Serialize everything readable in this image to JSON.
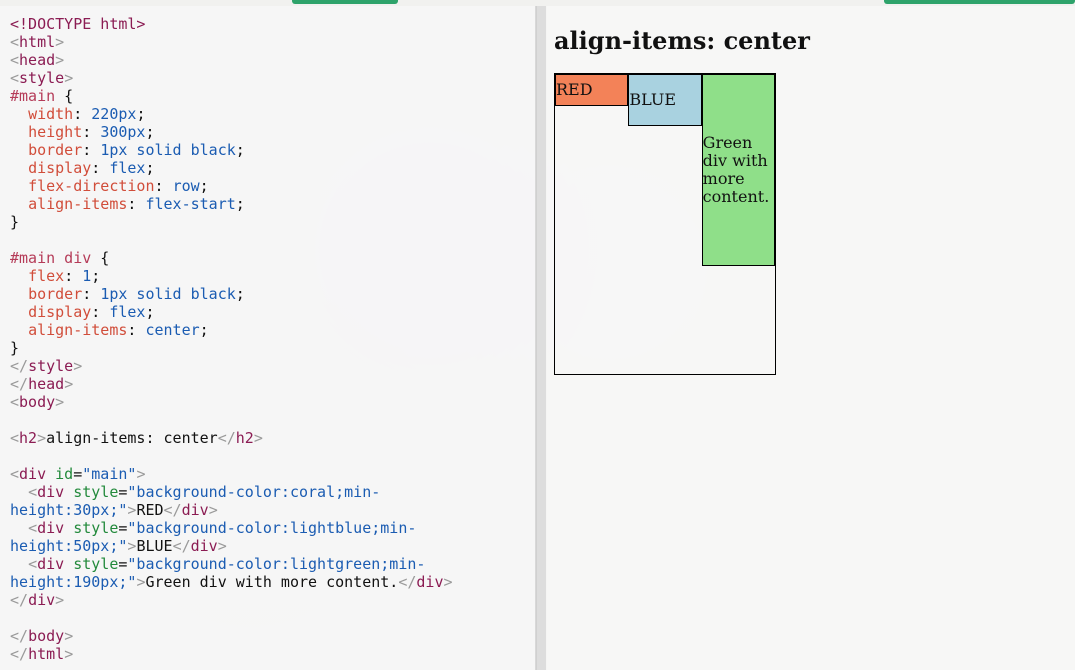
{
  "editor": {
    "lines": [
      [
        {
          "text": "<!DOCTYPE html>",
          "cls": "tok-tag"
        }
      ],
      [
        {
          "text": "<",
          "cls": "tok-bracket"
        },
        {
          "text": "html",
          "cls": "tok-tag"
        },
        {
          "text": ">",
          "cls": "tok-bracket"
        }
      ],
      [
        {
          "text": "<",
          "cls": "tok-bracket"
        },
        {
          "text": "head",
          "cls": "tok-tag"
        },
        {
          "text": ">",
          "cls": "tok-bracket"
        }
      ],
      [
        {
          "text": "<",
          "cls": "tok-bracket"
        },
        {
          "text": "style",
          "cls": "tok-tag"
        },
        {
          "text": ">",
          "cls": "tok-bracket"
        }
      ],
      [
        {
          "text": "#main",
          "cls": "tok-sel"
        },
        {
          "text": " {",
          "cls": "tok-punc"
        }
      ],
      [
        {
          "text": "  ",
          "cls": "tok-punc"
        },
        {
          "text": "width",
          "cls": "tok-prop"
        },
        {
          "text": ": ",
          "cls": "tok-punc"
        },
        {
          "text": "220px",
          "cls": "tok-val"
        },
        {
          "text": ";",
          "cls": "tok-punc"
        }
      ],
      [
        {
          "text": "  ",
          "cls": "tok-punc"
        },
        {
          "text": "height",
          "cls": "tok-prop"
        },
        {
          "text": ": ",
          "cls": "tok-punc"
        },
        {
          "text": "300px",
          "cls": "tok-val"
        },
        {
          "text": ";",
          "cls": "tok-punc"
        }
      ],
      [
        {
          "text": "  ",
          "cls": "tok-punc"
        },
        {
          "text": "border",
          "cls": "tok-prop"
        },
        {
          "text": ": ",
          "cls": "tok-punc"
        },
        {
          "text": "1px solid black",
          "cls": "tok-val"
        },
        {
          "text": ";",
          "cls": "tok-punc"
        }
      ],
      [
        {
          "text": "  ",
          "cls": "tok-punc"
        },
        {
          "text": "display",
          "cls": "tok-prop"
        },
        {
          "text": ": ",
          "cls": "tok-punc"
        },
        {
          "text": "flex",
          "cls": "tok-val"
        },
        {
          "text": ";",
          "cls": "tok-punc"
        }
      ],
      [
        {
          "text": "  ",
          "cls": "tok-punc"
        },
        {
          "text": "flex-direction",
          "cls": "tok-prop"
        },
        {
          "text": ": ",
          "cls": "tok-punc"
        },
        {
          "text": "row",
          "cls": "tok-val"
        },
        {
          "text": ";",
          "cls": "tok-punc"
        }
      ],
      [
        {
          "text": "  ",
          "cls": "tok-punc"
        },
        {
          "text": "align-items",
          "cls": "tok-prop"
        },
        {
          "text": ": ",
          "cls": "tok-punc"
        },
        {
          "text": "flex-start",
          "cls": "tok-val"
        },
        {
          "text": ";",
          "cls": "tok-punc"
        }
      ],
      [
        {
          "text": "}",
          "cls": "tok-punc"
        }
      ],
      [],
      [
        {
          "text": "#main div",
          "cls": "tok-sel"
        },
        {
          "text": " {",
          "cls": "tok-punc"
        }
      ],
      [
        {
          "text": "  ",
          "cls": "tok-punc"
        },
        {
          "text": "flex",
          "cls": "tok-prop"
        },
        {
          "text": ": ",
          "cls": "tok-punc"
        },
        {
          "text": "1",
          "cls": "tok-val"
        },
        {
          "text": ";",
          "cls": "tok-punc"
        }
      ],
      [
        {
          "text": "  ",
          "cls": "tok-punc"
        },
        {
          "text": "border",
          "cls": "tok-prop"
        },
        {
          "text": ": ",
          "cls": "tok-punc"
        },
        {
          "text": "1px solid black",
          "cls": "tok-val"
        },
        {
          "text": ";",
          "cls": "tok-punc"
        }
      ],
      [
        {
          "text": "  ",
          "cls": "tok-punc"
        },
        {
          "text": "display",
          "cls": "tok-prop"
        },
        {
          "text": ": ",
          "cls": "tok-punc"
        },
        {
          "text": "flex",
          "cls": "tok-val"
        },
        {
          "text": ";",
          "cls": "tok-punc"
        }
      ],
      [
        {
          "text": "  ",
          "cls": "tok-punc"
        },
        {
          "text": "align-items",
          "cls": "tok-prop"
        },
        {
          "text": ": ",
          "cls": "tok-punc"
        },
        {
          "text": "center",
          "cls": "tok-val"
        },
        {
          "text": ";",
          "cls": "tok-punc"
        }
      ],
      [
        {
          "text": "}",
          "cls": "tok-punc"
        }
      ],
      [
        {
          "text": "</",
          "cls": "tok-bracket"
        },
        {
          "text": "style",
          "cls": "tok-tag"
        },
        {
          "text": ">",
          "cls": "tok-bracket"
        }
      ],
      [
        {
          "text": "</",
          "cls": "tok-bracket"
        },
        {
          "text": "head",
          "cls": "tok-tag"
        },
        {
          "text": ">",
          "cls": "tok-bracket"
        }
      ],
      [
        {
          "text": "<",
          "cls": "tok-bracket"
        },
        {
          "text": "body",
          "cls": "tok-tag"
        },
        {
          "text": ">",
          "cls": "tok-bracket"
        }
      ],
      [],
      [
        {
          "text": "<",
          "cls": "tok-bracket"
        },
        {
          "text": "h2",
          "cls": "tok-tag"
        },
        {
          "text": ">",
          "cls": "tok-bracket"
        },
        {
          "text": "align-items: center",
          "cls": "tok-text"
        },
        {
          "text": "</",
          "cls": "tok-bracket"
        },
        {
          "text": "h2",
          "cls": "tok-tag"
        },
        {
          "text": ">",
          "cls": "tok-bracket"
        }
      ],
      [],
      [
        {
          "text": "<",
          "cls": "tok-bracket"
        },
        {
          "text": "div",
          "cls": "tok-tag"
        },
        {
          "text": " ",
          "cls": "tok-punc"
        },
        {
          "text": "id",
          "cls": "tok-attr"
        },
        {
          "text": "=",
          "cls": "tok-punc"
        },
        {
          "text": "\"main\"",
          "cls": "tok-str"
        },
        {
          "text": ">",
          "cls": "tok-bracket"
        }
      ],
      [
        {
          "text": "  ",
          "cls": "tok-punc"
        },
        {
          "text": "<",
          "cls": "tok-bracket"
        },
        {
          "text": "div",
          "cls": "tok-tag"
        },
        {
          "text": " ",
          "cls": "tok-punc"
        },
        {
          "text": "style",
          "cls": "tok-attr"
        },
        {
          "text": "=",
          "cls": "tok-punc"
        },
        {
          "text": "\"background-color:coral;min-",
          "cls": "tok-str"
        }
      ],
      [
        {
          "text": "height:30px;\"",
          "cls": "tok-str"
        },
        {
          "text": ">",
          "cls": "tok-bracket"
        },
        {
          "text": "RED",
          "cls": "tok-text"
        },
        {
          "text": "</",
          "cls": "tok-bracket"
        },
        {
          "text": "div",
          "cls": "tok-tag"
        },
        {
          "text": ">",
          "cls": "tok-bracket"
        }
      ],
      [
        {
          "text": "  ",
          "cls": "tok-punc"
        },
        {
          "text": "<",
          "cls": "tok-bracket"
        },
        {
          "text": "div",
          "cls": "tok-tag"
        },
        {
          "text": " ",
          "cls": "tok-punc"
        },
        {
          "text": "style",
          "cls": "tok-attr"
        },
        {
          "text": "=",
          "cls": "tok-punc"
        },
        {
          "text": "\"background-color:lightblue;min-",
          "cls": "tok-str"
        }
      ],
      [
        {
          "text": "height:50px;\"",
          "cls": "tok-str"
        },
        {
          "text": ">",
          "cls": "tok-bracket"
        },
        {
          "text": "BLUE",
          "cls": "tok-text"
        },
        {
          "text": "</",
          "cls": "tok-bracket"
        },
        {
          "text": "div",
          "cls": "tok-tag"
        },
        {
          "text": ">",
          "cls": "tok-bracket"
        }
      ],
      [
        {
          "text": "  ",
          "cls": "tok-punc"
        },
        {
          "text": "<",
          "cls": "tok-bracket"
        },
        {
          "text": "div",
          "cls": "tok-tag"
        },
        {
          "text": " ",
          "cls": "tok-punc"
        },
        {
          "text": "style",
          "cls": "tok-attr"
        },
        {
          "text": "=",
          "cls": "tok-punc"
        },
        {
          "text": "\"background-color:lightgreen;min-",
          "cls": "tok-str"
        }
      ],
      [
        {
          "text": "height:190px;\"",
          "cls": "tok-str"
        },
        {
          "text": ">",
          "cls": "tok-bracket"
        },
        {
          "text": "Green div with more content.",
          "cls": "tok-text"
        },
        {
          "text": "</",
          "cls": "tok-bracket"
        },
        {
          "text": "div",
          "cls": "tok-tag"
        },
        {
          "text": ">",
          "cls": "tok-bracket"
        }
      ],
      [
        {
          "text": "</",
          "cls": "tok-bracket"
        },
        {
          "text": "div",
          "cls": "tok-tag"
        },
        {
          "text": ">",
          "cls": "tok-bracket"
        }
      ],
      [],
      [
        {
          "text": "</",
          "cls": "tok-bracket"
        },
        {
          "text": "body",
          "cls": "tok-tag"
        },
        {
          "text": ">",
          "cls": "tok-bracket"
        }
      ],
      [
        {
          "text": "</",
          "cls": "tok-bracket"
        },
        {
          "text": "html",
          "cls": "tok-tag"
        },
        {
          "text": ">",
          "cls": "tok-bracket"
        }
      ]
    ]
  },
  "preview": {
    "title": "align-items: center",
    "boxes": {
      "red": "RED",
      "blue": "BLUE",
      "green": "Green div with more content."
    }
  },
  "colors": {
    "accent": "#2ea36b",
    "red": "#f38258",
    "blue": "#a9d2e0",
    "green": "#8fdf89"
  }
}
